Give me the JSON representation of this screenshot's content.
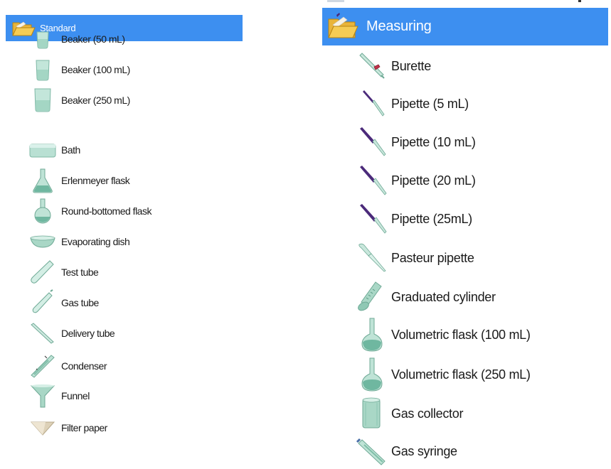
{
  "left_panel": {
    "header": {
      "label": "Standard",
      "icon": "folder-open-icon"
    },
    "items": [
      {
        "label": "Beaker (50 mL)",
        "icon": "beaker-small-icon"
      },
      {
        "label": "Beaker (100 mL)",
        "icon": "beaker-medium-icon"
      },
      {
        "label": "Beaker (250 mL)",
        "icon": "beaker-large-icon"
      },
      {
        "label": "Bath",
        "icon": "bath-icon"
      },
      {
        "label": "Erlenmeyer flask",
        "icon": "erlenmeyer-flask-icon"
      },
      {
        "label": "Round-bottomed flask",
        "icon": "round-bottomed-flask-icon"
      },
      {
        "label": "Evaporating dish",
        "icon": "evaporating-dish-icon"
      },
      {
        "label": "Test tube",
        "icon": "test-tube-icon"
      },
      {
        "label": "Gas tube",
        "icon": "gas-tube-icon"
      },
      {
        "label": "Delivery tube",
        "icon": "delivery-tube-icon"
      },
      {
        "label": "Condenser",
        "icon": "condenser-icon"
      },
      {
        "label": "Funnel",
        "icon": "funnel-icon"
      },
      {
        "label": "Filter paper",
        "icon": "filter-paper-icon"
      }
    ]
  },
  "right_panel": {
    "header": {
      "label": "Measuring",
      "icon": "folder-open-icon"
    },
    "items": [
      {
        "label": "Burette",
        "icon": "burette-icon"
      },
      {
        "label": "Pipette (5 mL)",
        "icon": "pipette-icon"
      },
      {
        "label": "Pipette (10 mL)",
        "icon": "pipette-icon"
      },
      {
        "label": "Pipette (20 mL)",
        "icon": "pipette-icon"
      },
      {
        "label": "Pipette (25mL)",
        "icon": "pipette-icon"
      },
      {
        "label": "Pasteur pipette",
        "icon": "pasteur-pipette-icon"
      },
      {
        "label": "Graduated cylinder",
        "icon": "graduated-cylinder-icon"
      },
      {
        "label": "Volumetric flask (100 mL)",
        "icon": "volumetric-flask-icon"
      },
      {
        "label": "Volumetric flask (250 mL)",
        "icon": "volumetric-flask-icon"
      },
      {
        "label": "Gas collector",
        "icon": "gas-collector-icon"
      },
      {
        "label": "Gas syringe",
        "icon": "gas-syringe-icon"
      }
    ]
  },
  "colors": {
    "header_bg": "#3d8ff0",
    "header_text": "#ffffff",
    "glass": "#a8d8c8",
    "glass_dark": "#5fa891",
    "pipette_purple": "#4b2a7a"
  }
}
